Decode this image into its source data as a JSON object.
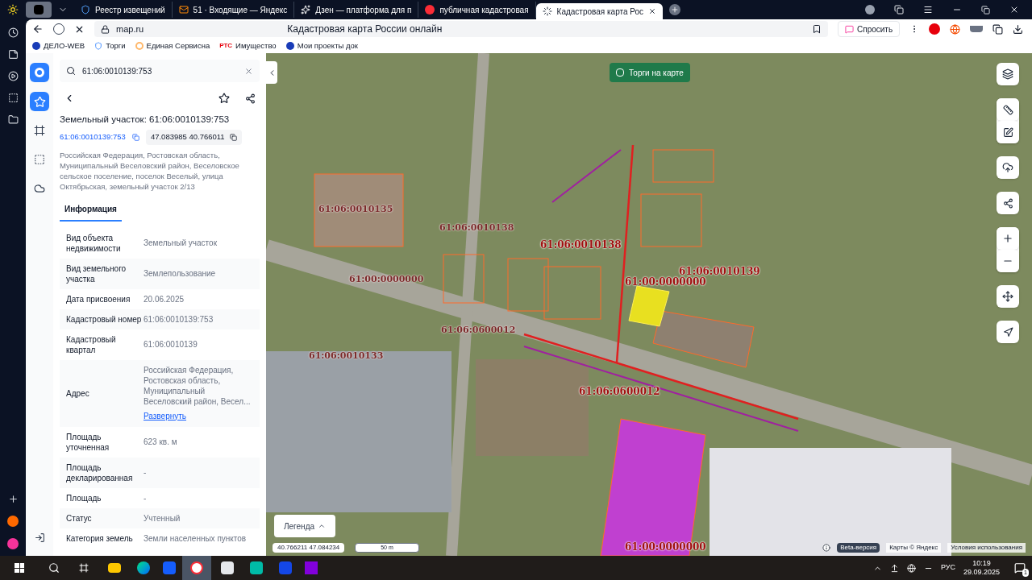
{
  "browser": {
    "tabs": [
      {
        "label": "Реестр извещений",
        "selected": false
      },
      {
        "label": "51 · Входящие — Яндекс",
        "selected": false
      },
      {
        "label": "Дзен — платформа для п",
        "selected": false
      },
      {
        "label": "публичная кадастровая",
        "selected": false
      },
      {
        "label": "Кадастровая карта Рос",
        "selected": true
      }
    ],
    "address": "map.ru",
    "page_title": "Кадастровая карта России онлайн",
    "ask_button": "Спросить",
    "bookmarks": [
      {
        "label": "ДЕЛО-WEB"
      },
      {
        "label": "Торги"
      },
      {
        "label": "Единая Сервисна"
      },
      {
        "label": "Имущество",
        "logo_text": "РТС"
      },
      {
        "label": "Мои проекты док"
      }
    ]
  },
  "rail": {
    "items": [
      {
        "kind": "star",
        "selected": true
      },
      {
        "kind": "polygon",
        "selected": false
      },
      {
        "kind": "select",
        "selected": false
      },
      {
        "kind": "cloud",
        "selected": false
      }
    ]
  },
  "panel": {
    "search": {
      "value": "61:06:0010139:753"
    },
    "title": "Земельный участок: 61:06:0010139:753",
    "cad_link": "61:06:0010139:753",
    "coords": "47.083985 40.766011",
    "address": "Российская Федерация, Ростовская область, Муниципальный Веселовский район, Веселовское сельское поселение, поселок Веселый, улица Октябрьская, земельный участок 2/13",
    "tabs": [
      {
        "label": "Информация",
        "selected": true
      }
    ],
    "rows": [
      {
        "label": "Вид объекта недвижимости",
        "value": "Земельный участок"
      },
      {
        "label": "Вид земельного участка",
        "value": "Землепользование"
      },
      {
        "label": "Дата присвоения",
        "value": "20.06.2025"
      },
      {
        "label": "Кадастровый номер",
        "value": "61:06:0010139:753"
      },
      {
        "label": "Кадастровый квартал",
        "value": "61:06:0010139"
      },
      {
        "label": "Адрес",
        "value": "Российская Федерация, Ростовская область, Муниципальный Веселовский район, Весел...",
        "link": "Развернуть"
      },
      {
        "label": "Площадь уточненная",
        "value": "623 кв. м"
      },
      {
        "label": "Площадь декларированная",
        "value": "-"
      },
      {
        "label": "Площадь",
        "value": "-"
      },
      {
        "label": "Статус",
        "value": "Учтенный"
      },
      {
        "label": "Категория земель",
        "value": "Земли населенных пунктов"
      }
    ]
  },
  "map": {
    "trade_button": "Торги на карте",
    "labels": [
      {
        "text": "61:06:0010138",
        "kind": "main"
      },
      {
        "text": "61:06:0010139",
        "kind": "main"
      },
      {
        "text": "61:00:0000000",
        "kind": "main"
      },
      {
        "text": "61:06:0600012",
        "kind": "main"
      },
      {
        "text": "61:00:0000000",
        "kind": "main"
      },
      {
        "text": "61:06:0010138",
        "kind": "faded"
      },
      {
        "text": "61:00:0000000",
        "kind": "faded"
      },
      {
        "text": "61:06:0600012",
        "kind": "faded"
      },
      {
        "text": "61:06:0010135",
        "kind": "faded"
      },
      {
        "text": "61:06:0010133",
        "kind": "faded"
      }
    ],
    "legend_button": "Легенда",
    "coords": "40.766211 47.084234",
    "scale": "50 m",
    "beta": "Beta-версия",
    "copyright": "Карты © Яндекс",
    "terms": "Условия использования"
  },
  "taskbar": {
    "lang": "РУС",
    "time": "10:19",
    "date": "29.09.2025",
    "notifications": "1"
  }
}
